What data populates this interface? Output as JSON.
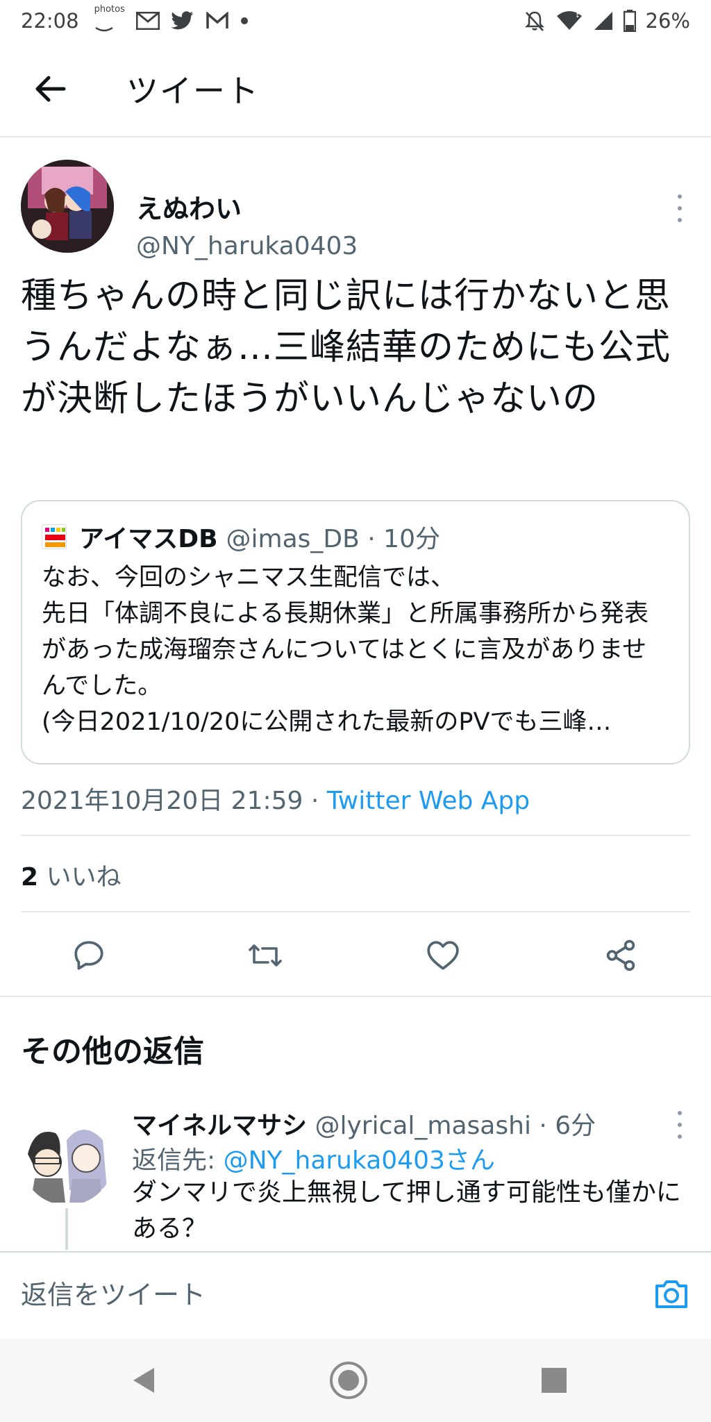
{
  "status_bar": {
    "time": "22:08",
    "photos_label": "photos",
    "battery": "26%"
  },
  "app_bar": {
    "title": "ツイート"
  },
  "tweet": {
    "author_name": "えぬわい",
    "author_handle": "@NY_haruka0403",
    "text": "種ちゃんの時と同じ訳には行かないと思うんだよなぁ…三峰結華のためにも公式が決断したほうがいいんじゃないの",
    "quote": {
      "name": "アイマスDB",
      "meta": "@imas_DB · 10分",
      "text": "なお、今回のシャニマス生配信では、\n先日「体調不良による長期休業」と所属事務所から発表があった成海瑠奈さんについてはとくに言及がありませんでした。\n(今日2021/10/20に公開された最新のPVでも三峰…"
    },
    "timestamp": "2021年10月20日 21:59 · ",
    "via": "Twitter Web App",
    "likes_count": "2",
    "likes_label": " いいね"
  },
  "replies_section": {
    "title": "その他の返信",
    "reply": {
      "name": "マイネルマサシ",
      "meta": " @lyrical_masashi · 6分",
      "reply_to_label": "返信先: ",
      "reply_to_mention": "@NY_haruka0403さん",
      "text": "ダンマリで炎上無視して押し通す可能性も僅かにある？"
    }
  },
  "composer": {
    "placeholder": "返信をツイート"
  },
  "colors": {
    "accent": "#1d9bf0",
    "secondary_text": "#536471",
    "border": "#cfd9de"
  }
}
